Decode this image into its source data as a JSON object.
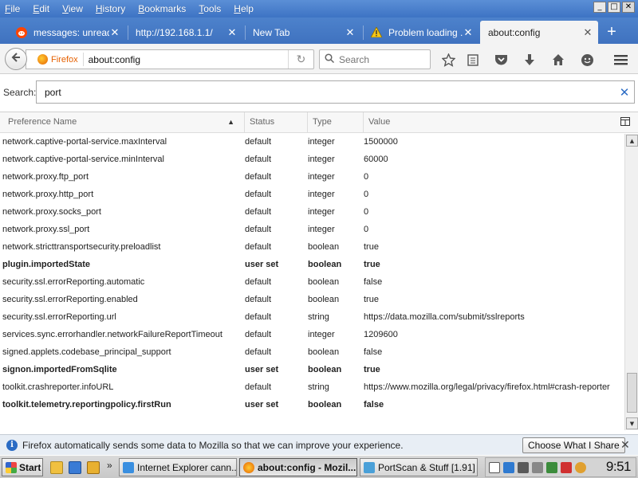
{
  "menu": [
    "File",
    "Edit",
    "View",
    "History",
    "Bookmarks",
    "Tools",
    "Help"
  ],
  "window_controls": {
    "minimize": "_",
    "maximize": "□",
    "close": "✕"
  },
  "tabs": [
    {
      "label": "messages: unread",
      "icon": "reddit-icon",
      "close": "✕"
    },
    {
      "label": "http://192.168.1.1/",
      "icon": "",
      "close": "✕"
    },
    {
      "label": "New Tab",
      "icon": "",
      "close": "✕"
    },
    {
      "label": "Problem loading ...",
      "icon": "warning-icon",
      "close": "✕"
    },
    {
      "label": "about:config",
      "icon": "",
      "close": "✕",
      "active": true
    }
  ],
  "new_tab": "+",
  "navbar": {
    "identity": "Firefox",
    "url": "about:config",
    "search_placeholder": "Search"
  },
  "config_search": {
    "label": "Search:",
    "value": "port",
    "clear": "✕"
  },
  "columns": [
    "Preference Name",
    "Status",
    "Type",
    "Value"
  ],
  "rows": [
    {
      "name": "network.captive-portal-service.maxInterval",
      "status": "default",
      "type": "integer",
      "value": "1500000",
      "bold": false
    },
    {
      "name": "network.captive-portal-service.minInterval",
      "status": "default",
      "type": "integer",
      "value": "60000",
      "bold": false
    },
    {
      "name": "network.proxy.ftp_port",
      "status": "default",
      "type": "integer",
      "value": "0",
      "bold": false
    },
    {
      "name": "network.proxy.http_port",
      "status": "default",
      "type": "integer",
      "value": "0",
      "bold": false
    },
    {
      "name": "network.proxy.socks_port",
      "status": "default",
      "type": "integer",
      "value": "0",
      "bold": false
    },
    {
      "name": "network.proxy.ssl_port",
      "status": "default",
      "type": "integer",
      "value": "0",
      "bold": false
    },
    {
      "name": "network.stricttransportsecurity.preloadlist",
      "status": "default",
      "type": "boolean",
      "value": "true",
      "bold": false
    },
    {
      "name": "plugin.importedState",
      "status": "user set",
      "type": "boolean",
      "value": "true",
      "bold": true
    },
    {
      "name": "security.ssl.errorReporting.automatic",
      "status": "default",
      "type": "boolean",
      "value": "false",
      "bold": false
    },
    {
      "name": "security.ssl.errorReporting.enabled",
      "status": "default",
      "type": "boolean",
      "value": "true",
      "bold": false
    },
    {
      "name": "security.ssl.errorReporting.url",
      "status": "default",
      "type": "string",
      "value": "https://data.mozilla.com/submit/sslreports",
      "bold": false
    },
    {
      "name": "services.sync.errorhandler.networkFailureReportTimeout",
      "status": "default",
      "type": "integer",
      "value": "1209600",
      "bold": false
    },
    {
      "name": "signed.applets.codebase_principal_support",
      "status": "default",
      "type": "boolean",
      "value": "false",
      "bold": false
    },
    {
      "name": "signon.importedFromSqlite",
      "status": "user set",
      "type": "boolean",
      "value": "true",
      "bold": true
    },
    {
      "name": "toolkit.crashreporter.infoURL",
      "status": "default",
      "type": "string",
      "value": "https://www.mozilla.org/legal/privacy/firefox.html#crash-reporter",
      "bold": false
    },
    {
      "name": "toolkit.telemetry.reportingpolicy.firstRun",
      "status": "user set",
      "type": "boolean",
      "value": "false",
      "bold": true
    }
  ],
  "notification": {
    "text": "Firefox automatically sends some data to Mozilla so that we can improve your experience.",
    "button": "Choose What I Share",
    "close": "✕"
  },
  "taskbar": {
    "start": "Start",
    "tasks": [
      {
        "label": "Internet Explorer cann...",
        "active": false
      },
      {
        "label": "about:config - Mozil...",
        "active": true
      },
      {
        "label": "PortScan & Stuff [1.91]",
        "active": false
      }
    ],
    "clock": "9:51"
  },
  "colors": {
    "accent": "#2a6bc4",
    "firefox_orange": "#e66000",
    "titlebar": "#4d82cc"
  }
}
